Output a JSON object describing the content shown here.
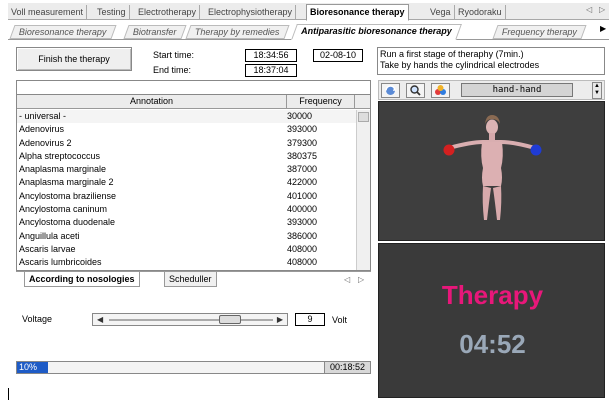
{
  "top_tabs": [
    {
      "label": "Voll measurement",
      "active": false
    },
    {
      "label": "Testing",
      "active": false
    },
    {
      "label": "Electrotherapy",
      "active": false
    },
    {
      "label": "Electrophysiotherapy",
      "active": false
    },
    {
      "label": "Bioresonance therapy",
      "active": true
    },
    {
      "label": "Vega",
      "active": false
    },
    {
      "label": "Ryodoraku",
      "active": false
    }
  ],
  "sub_tabs": [
    {
      "label": "Bioresonance therapy",
      "active": false
    },
    {
      "label": "Biotransfer",
      "active": false
    },
    {
      "label": "Therapy by remedies",
      "active": false
    },
    {
      "label": "Antiparasitic bioresonance therapy",
      "active": true
    },
    {
      "label": "Frequency therapy",
      "active": false
    }
  ],
  "controls": {
    "finish_label": "Finish the therapy",
    "start_label": "Start time:",
    "start_time": "18:34:56",
    "date": "02-08-10",
    "end_label": "End time:",
    "end_time": "18:37:04"
  },
  "info": {
    "line1": "Run a first stage of theraphy  (7min.)",
    "line2": "Take by hands the cylindrical electrodes"
  },
  "table": {
    "col_annotation": "Annotation",
    "col_frequency": "Frequency",
    "rows": [
      {
        "name": " - universal -",
        "freq": "30000"
      },
      {
        "name": "Adenovirus",
        "freq": "393000"
      },
      {
        "name": "Adenovirus 2",
        "freq": "379300"
      },
      {
        "name": "Alpha streptococcus",
        "freq": "380375"
      },
      {
        "name": "Anaplasma marginale",
        "freq": "387000"
      },
      {
        "name": "Anaplasma marginale 2",
        "freq": "422000"
      },
      {
        "name": "Ancylostoma braziliense",
        "freq": "401000"
      },
      {
        "name": "Ancylostoma caninum",
        "freq": "400000"
      },
      {
        "name": "Ancylostoma duodenale",
        "freq": "393000"
      },
      {
        "name": "Anguillula aceti",
        "freq": "386000"
      },
      {
        "name": "Ascaris larvae",
        "freq": "408000"
      },
      {
        "name": "Ascaris lumbricoides",
        "freq": "408000"
      }
    ]
  },
  "bottom_tabs": [
    {
      "label": "According to nosologies",
      "active": true
    },
    {
      "label": "Scheduller",
      "active": false
    }
  ],
  "voltage": {
    "label": "Voltage",
    "value": "9",
    "unit": "Volt",
    "level": 0.74
  },
  "progress": {
    "percent_label": "10%",
    "fraction": 0.1,
    "remaining": "00:18:52"
  },
  "viewer": {
    "mode": "hand-hand"
  },
  "therapy": {
    "title": "Therapy",
    "timer": "04:52"
  },
  "colors": {
    "therapy_title": "#e8177a",
    "timer": "#9aa8b8",
    "progress_fill": "#1e5bc6",
    "electrode_left": "#d42020",
    "electrode_right": "#1f3bd4"
  }
}
